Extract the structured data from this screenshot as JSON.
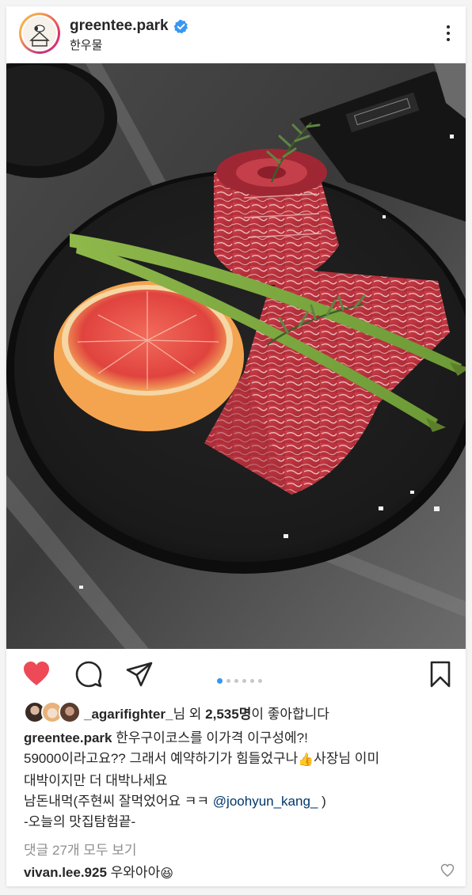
{
  "post": {
    "username": "greentee.park",
    "verified": true,
    "location": "한우물"
  },
  "carousel": {
    "total": 6,
    "active_index": 0
  },
  "actions": {
    "liked": true,
    "icons": [
      "heart-icon",
      "comment-icon",
      "share-icon",
      "bookmark-icon"
    ]
  },
  "likes": {
    "liker": "_agarifighter_",
    "suffix_1": "님 외 ",
    "count": "2,535명",
    "suffix_2": "이 좋아합니다"
  },
  "caption": {
    "username": "greentee.park",
    "line1": " 한우구이코스를 이가격 이구성에?!",
    "line2a": "59000이라고요?? 그래서 예약하기가 힘들었구나",
    "emoji1": "👍",
    "line2b": "사장님 이미",
    "line3": "대박이지만 더 대박나세요",
    "line4a": "남돈내먹(주현씨 잘먹었어요 ㅋㅋ ",
    "mention": "@joohyun_kang_",
    "line4b": " )",
    "line5": "-오늘의 맛집탐험끝-"
  },
  "comments_link": "댓글 27개 모두 보기",
  "comment": {
    "username": "vivan.lee.925",
    "text": " 우와아아",
    "emoji": "😆"
  },
  "colors": {
    "like_red": "#ed4956",
    "verified_blue": "#3897f0",
    "mention_blue": "#00376b",
    "muted_gray": "#8e8e8e"
  }
}
